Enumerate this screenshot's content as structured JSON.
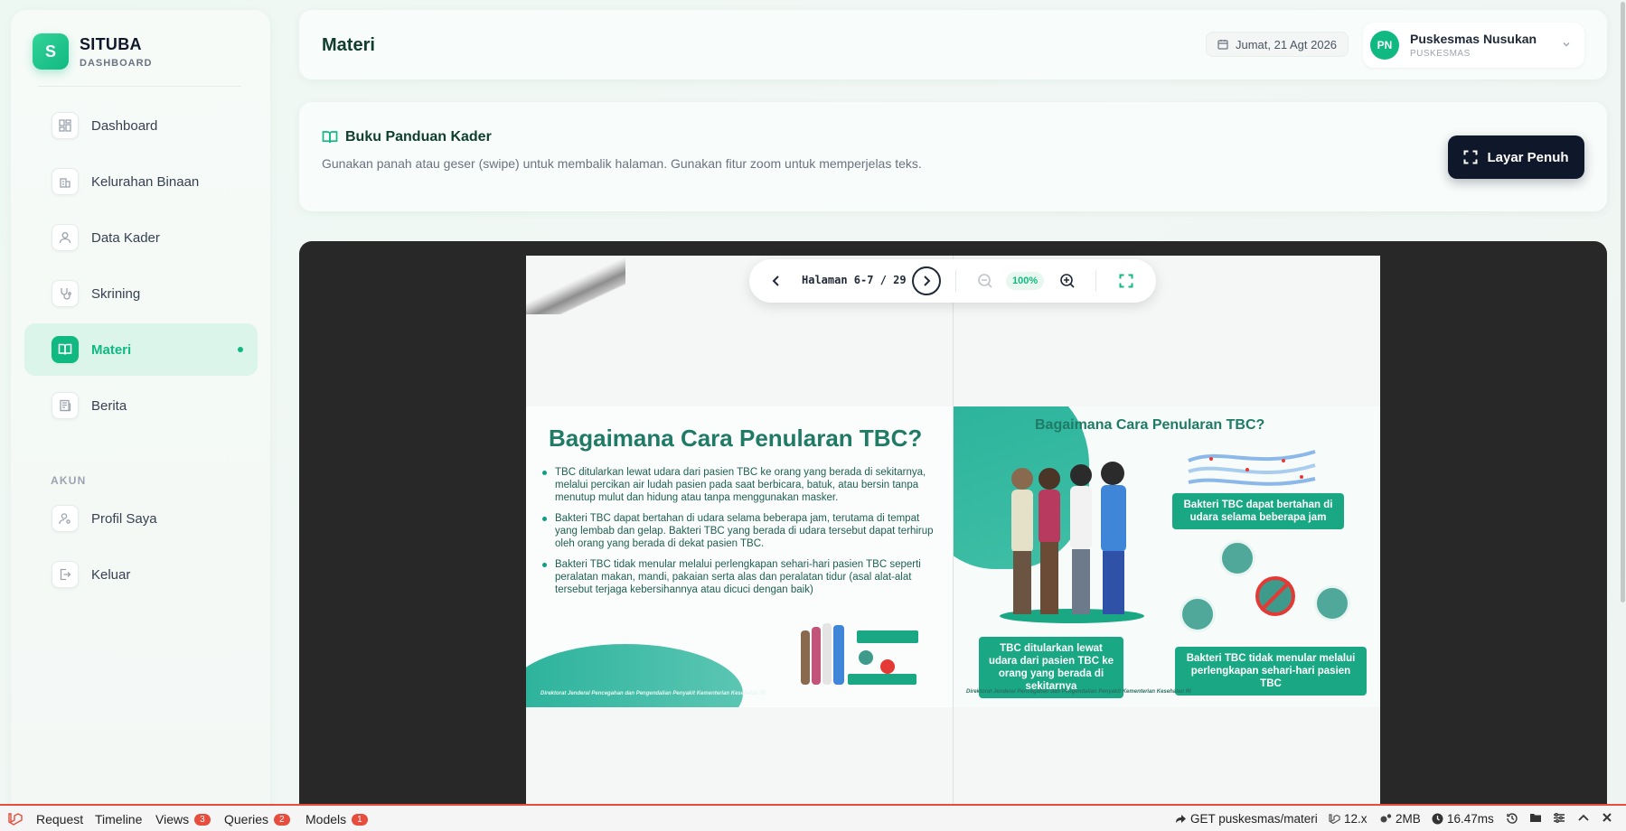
{
  "sidebar": {
    "brand_letter": "S",
    "brand_name": "SITUBA",
    "brand_sub": "DASHBOARD",
    "items": [
      {
        "label": "Dashboard",
        "icon": "grid-icon"
      },
      {
        "label": "Kelurahan Binaan",
        "icon": "building-icon"
      },
      {
        "label": "Data Kader",
        "icon": "user-icon"
      },
      {
        "label": "Skrining",
        "icon": "stethoscope-icon"
      },
      {
        "label": "Materi",
        "icon": "book-icon",
        "active": true
      },
      {
        "label": "Berita",
        "icon": "newspaper-icon"
      }
    ],
    "section_label": "AKUN",
    "account_items": [
      {
        "label": "Profil Saya",
        "icon": "user-settings-icon"
      },
      {
        "label": "Keluar",
        "icon": "logout-icon"
      }
    ]
  },
  "header": {
    "title": "Materi",
    "date": "Jumat, 21 Agt 2026",
    "profile": {
      "initials": "PN",
      "name": "Puskesmas Nusukan",
      "role": "PUSKESMAS"
    }
  },
  "info": {
    "title": "Buku Panduan Kader",
    "description": "Gunakan panah atau geser (swipe) untuk membalik halaman. Gunakan fitur zoom untuk memperjelas teks.",
    "fullscreen_label": "Layar Penuh"
  },
  "viewer": {
    "page_indicator": "Halaman 6-7 / 29",
    "zoom": "100%",
    "left_page": {
      "title": "Bagaimana Cara Penularan TBC?",
      "bullets": [
        "TBC ditularkan lewat udara dari pasien TBC ke orang yang berada di sekitarnya, melalui percikan air ludah pasien pada saat berbicara, batuk, atau bersin tanpa menutup mulut dan hidung atau tanpa menggunakan masker.",
        "Bakteri TBC  dapat bertahan di udara selama beberapa jam, terutama di tempat yang lembab dan gelap. Bakteri TBC yang berada di udara tersebut  dapat terhirup oleh orang yang berada di dekat pasien TBC.",
        "Bakteri TBC tidak menular melalui perlengkapan sehari-hari pasien TBC seperti peralatan makan, mandi, pakaian serta alas dan peralatan tidur (asal alat-alat tersebut terjaga kebersihannya atau dicuci dengan baik)"
      ],
      "footer": "Direktorat Jenderal Pencegahan dan Pengendalian Penyakit Kementerian Kesehatan RI"
    },
    "right_page": {
      "title": "Bagaimana Cara Penularan TBC?",
      "box_air": "Bakteri  TBC  dapat bertahan di udara selama beberapa jam",
      "box_spread": "TBC ditularkan lewat udara dari pasien TBC ke orang yang berada di sekitarnya",
      "box_items": "Bakteri TBC tidak menular melalui perlengkapan sehari-hari pasien TBC",
      "footer": "Direktorat Jenderal Pencegahan dan Pengendalian Penyakit Kementerian Kesehatan RI"
    }
  },
  "debugbar": {
    "tabs": [
      {
        "label": "Request"
      },
      {
        "label": "Timeline"
      },
      {
        "label": "Views",
        "badge": "3"
      },
      {
        "label": "Queries",
        "badge": "2"
      },
      {
        "label": "Models",
        "badge": "1"
      }
    ],
    "route": "GET puskesmas/materi",
    "version": "12.x",
    "memory": "2MB",
    "time": "16.47ms"
  },
  "colors": {
    "accent": "#10b981",
    "dark": "#0f172a",
    "debug_red": "#e74c3c"
  }
}
